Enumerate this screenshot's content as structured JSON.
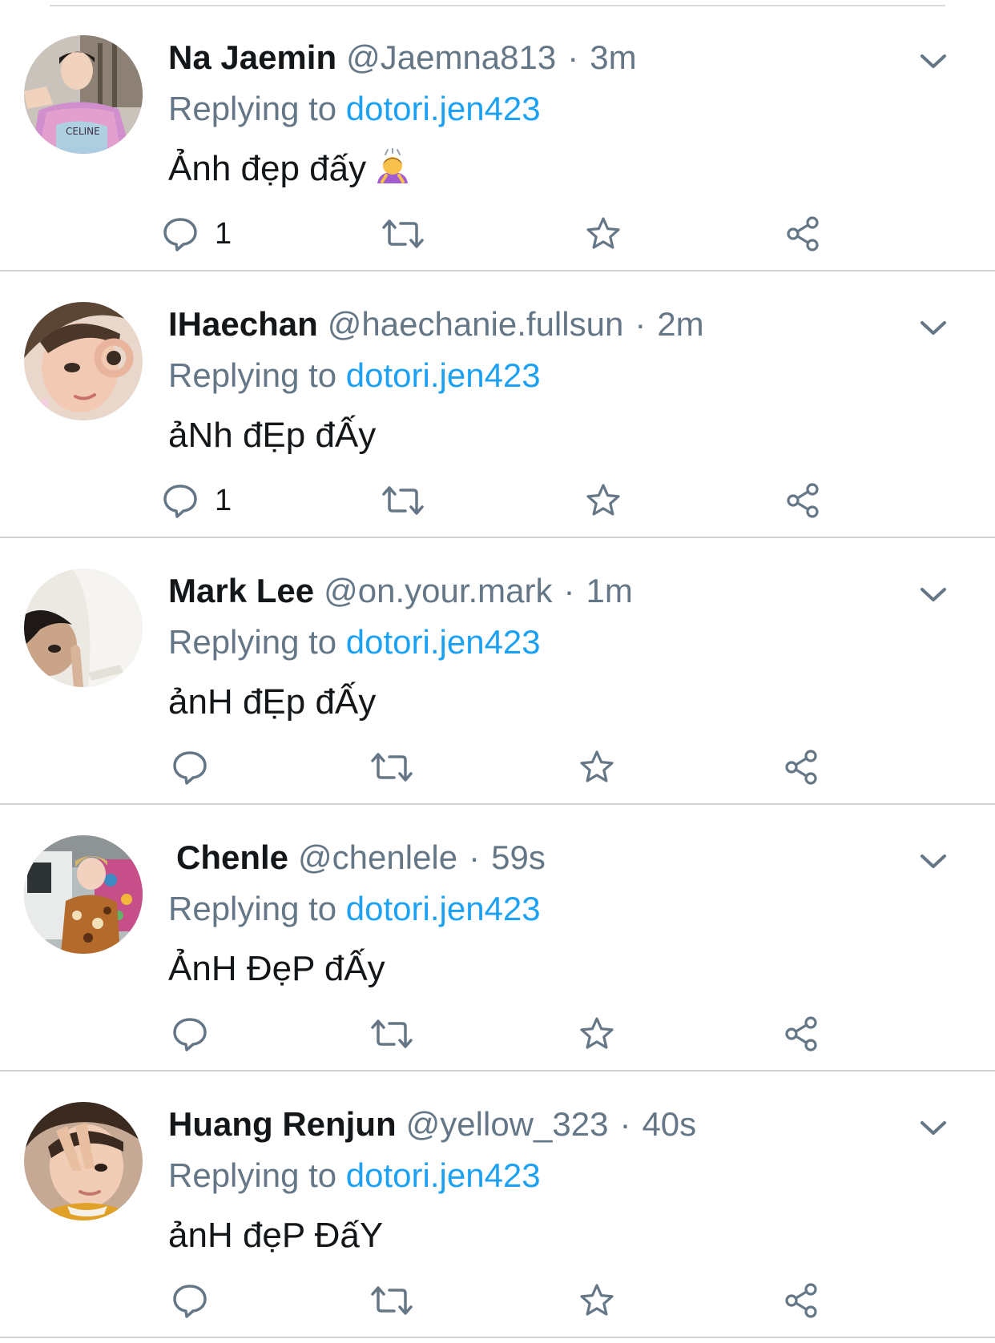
{
  "colors": {
    "name": "#14171a",
    "secondary": "#657786",
    "link": "#1da1f2",
    "icon": "#657786",
    "divider": "#cdd2d7"
  },
  "replies": [
    {
      "name": "Na Jaemin",
      "handle": "@Jaemna813",
      "separator": "·",
      "time": "3m",
      "replying_prefix": "Replying to",
      "replying_to": "dotori.jen423",
      "text": "Ảnh đẹp đấy",
      "emoji_icon": "person-bowing-emoji-icon",
      "reply_count": "1"
    },
    {
      "name": "IHaechan",
      "handle": "@haechanie.fullsun",
      "separator": "·",
      "time": "2m",
      "replying_prefix": "Replying to",
      "replying_to": "dotori.jen423",
      "text": "ảNh đẸp đẤy",
      "reply_count": "1"
    },
    {
      "name": "Mark Lee",
      "handle": "@on.your.mark",
      "separator": "·",
      "time": "1m",
      "replying_prefix": "Replying to",
      "replying_to": "dotori.jen423",
      "text": "ảnH đẸp đẤy",
      "reply_count": ""
    },
    {
      "name": "Chenle",
      "handle": "@chenlele",
      "separator": "·",
      "time": "59s",
      "replying_prefix": "Replying to",
      "replying_to": "dotori.jen423",
      "text": "ẢnH ĐẹP đẤy",
      "reply_count": ""
    },
    {
      "name": "Huang Renjun",
      "handle": "@yellow_323",
      "separator": "·",
      "time": "40s",
      "replying_prefix": "Replying to",
      "replying_to": "dotori.jen423",
      "text": "ảnH đẹP ĐấY",
      "reply_count": ""
    }
  ],
  "icons": {
    "reply": "speech-bubble-icon",
    "retweet": "retweet-icon",
    "like": "star-icon",
    "share": "share-icon",
    "menu": "chevron-down-icon"
  }
}
